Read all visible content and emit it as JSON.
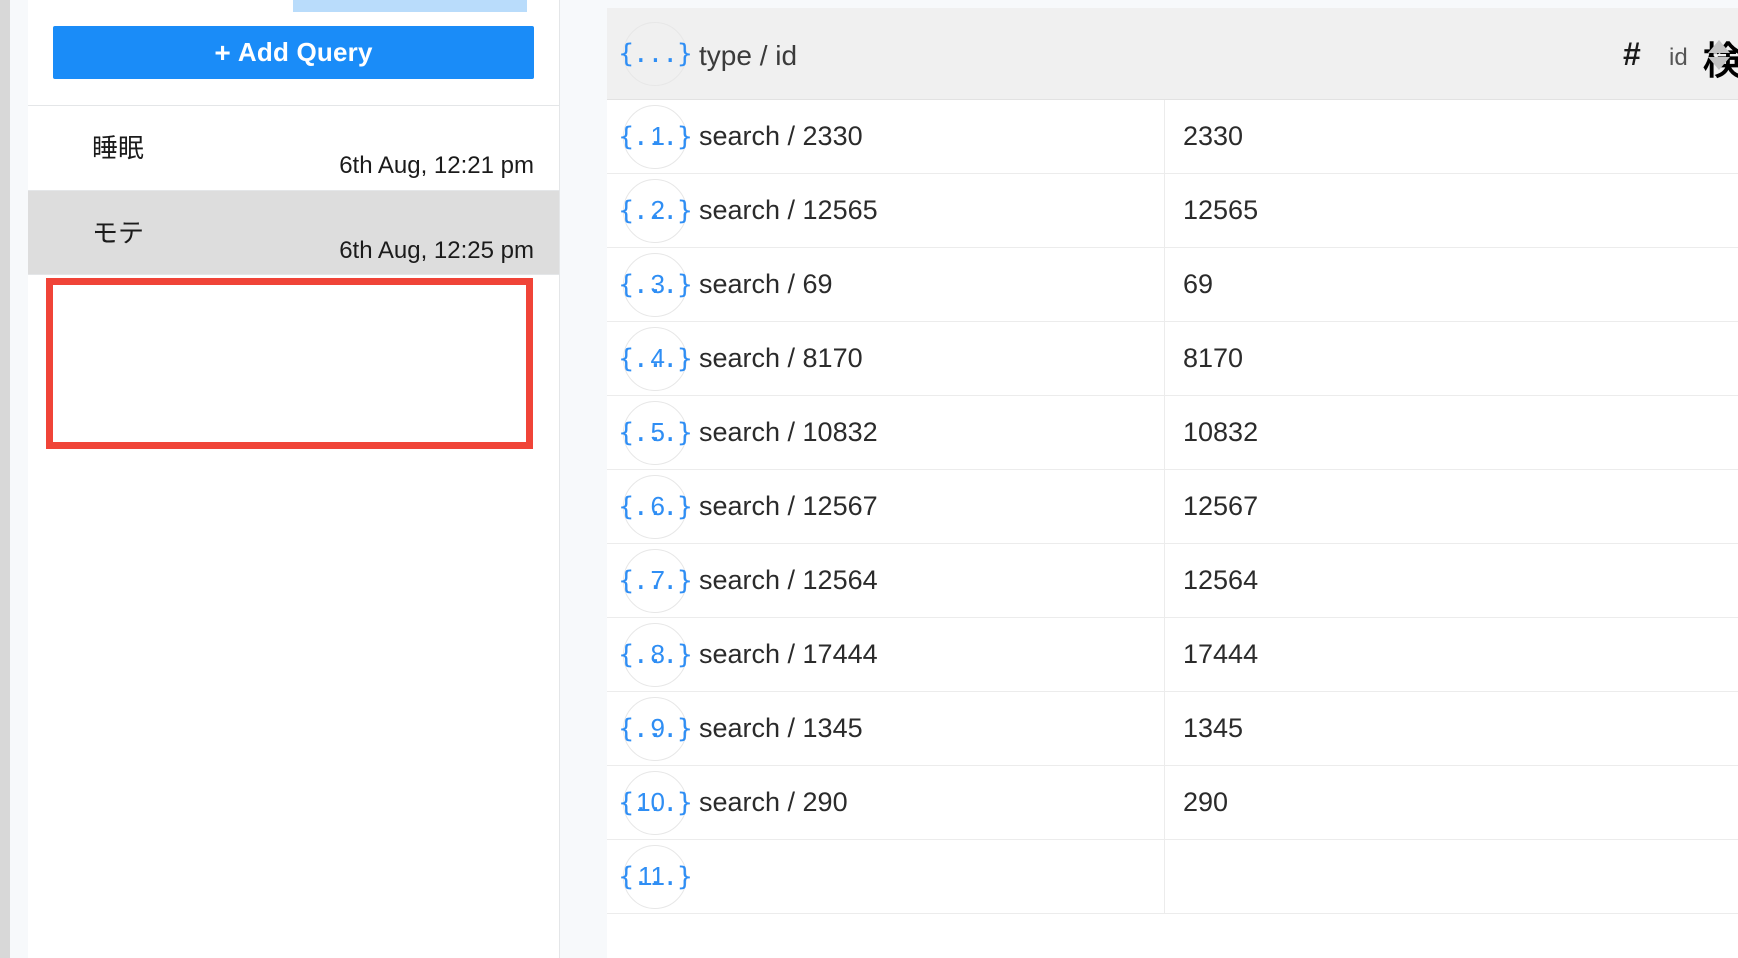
{
  "sidebar": {
    "add_query_label": "Add Query",
    "add_query_plus": "+",
    "items": [
      {
        "title": "睡眠",
        "time": "6th Aug, 12:21 pm",
        "selected": false
      },
      {
        "title": "モテ",
        "time": "6th Aug, 12:25 pm",
        "selected": true
      }
    ]
  },
  "table": {
    "columns": [
      {
        "icon": "braces-icon",
        "icon_glyph": "{...}",
        "label": "type / id"
      },
      {
        "icon": "hash-icon",
        "icon_glyph": "#",
        "label": "id"
      }
    ],
    "annotation": "検索結果が返ってくる",
    "sort_indicator": "sort-updown-icon",
    "rows": [
      {
        "n": "1",
        "type": "search / 2330",
        "id": "2330"
      },
      {
        "n": "2",
        "type": "search / 12565",
        "id": "12565"
      },
      {
        "n": "3",
        "type": "search / 69",
        "id": "69"
      },
      {
        "n": "4",
        "type": "search / 8170",
        "id": "8170"
      },
      {
        "n": "5",
        "type": "search / 10832",
        "id": "10832"
      },
      {
        "n": "6",
        "type": "search / 12567",
        "id": "12567"
      },
      {
        "n": "7",
        "type": "search / 12564",
        "id": "12564"
      },
      {
        "n": "8",
        "type": "search / 17444",
        "id": "17444"
      },
      {
        "n": "9",
        "type": "search / 1345",
        "id": "1345"
      },
      {
        "n": "10",
        "type": "search / 290",
        "id": "290"
      },
      {
        "n": "11",
        "type": "",
        "id": ""
      }
    ]
  },
  "colors": {
    "accent_blue": "#1a8cf8",
    "row_number_blue": "#2f8ef4",
    "highlight_red": "#f04438",
    "selection_blue": "#b9dcfb",
    "selected_row_gray": "#dddddd",
    "header_gray": "#f0f0f0"
  }
}
